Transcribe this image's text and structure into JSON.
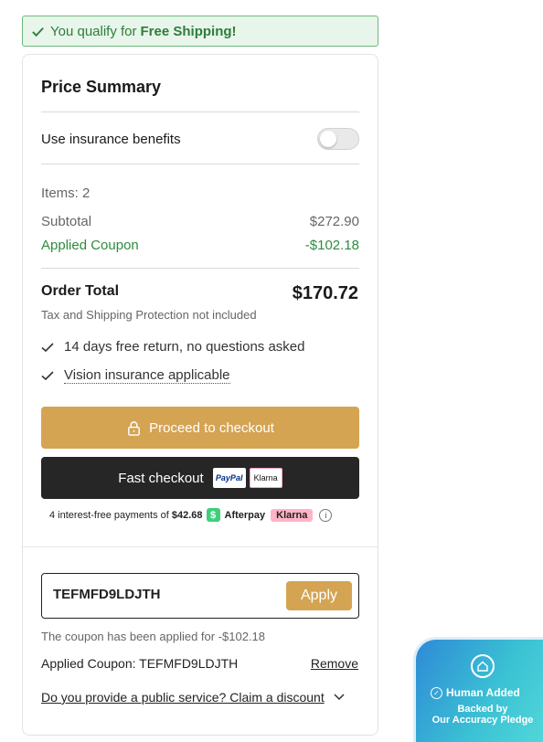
{
  "banner": {
    "prefix": "You qualify for",
    "bold": "Free Shipping!",
    "colors": {
      "background": "#e8f5ea",
      "border": "#6fb87d",
      "text": "#2e7d3a"
    }
  },
  "summary": {
    "title": "Price Summary",
    "insurance_label": "Use insurance benefits",
    "insurance_enabled": false,
    "items_label": "Items: 2",
    "subtotal_label": "Subtotal",
    "subtotal_value": "$272.90",
    "coupon_label": "Applied Coupon",
    "coupon_value": "-$102.18",
    "total_label": "Order Total",
    "total_value": "$170.72",
    "tax_note": "Tax and Shipping Protection not included",
    "features": [
      "14 days free return, no questions asked",
      "Vision insurance applicable"
    ]
  },
  "buttons": {
    "checkout_label": "Proceed to checkout",
    "fast_checkout_label": "Fast checkout",
    "paypal_badge": "PayPal",
    "klarna_badge": "Klarna",
    "accent_color": "#d4a453"
  },
  "installments": {
    "text": "4 interest-free payments of",
    "amount": "$42.68",
    "afterpay_icon": "$",
    "afterpay_label": "Afterpay",
    "klarna_label": "Klarna"
  },
  "coupon": {
    "input_value": "TEFMFD9LDJTH",
    "apply_label": "Apply",
    "applied_message": "The coupon has been applied for -$102.18",
    "applied_code_text": "Applied Coupon: TEFMFD9LDJTH",
    "remove_label": "Remove",
    "public_service_label": "Do you provide a public service? Claim a discount"
  },
  "badge": {
    "human_added": "Human Added",
    "backed_by": "Backed by",
    "pledge": "Our Accuracy Pledge"
  }
}
